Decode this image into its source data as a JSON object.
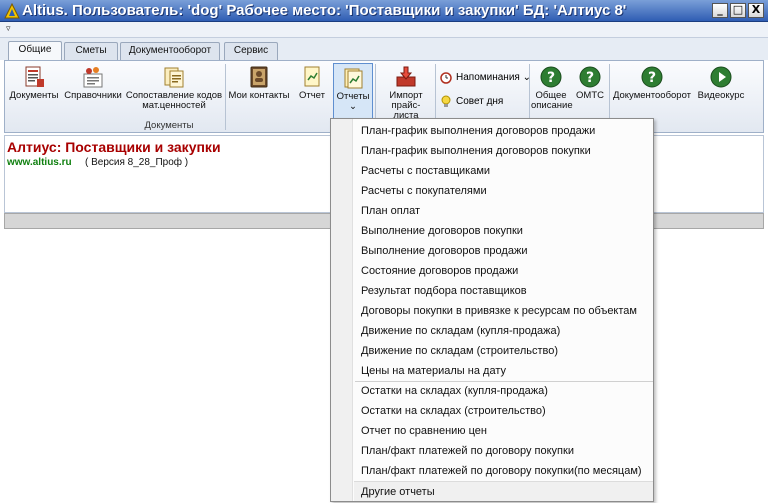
{
  "window": {
    "title": "Altius. Пользователь: 'dog' Рабочее место: 'Поставщики и закупки' БД: 'Алтиус 8'",
    "controls": [
      "_",
      "□",
      "X"
    ]
  },
  "qat": {
    "drop": "▿"
  },
  "tabs": [
    {
      "label": "Общие",
      "active": true
    },
    {
      "label": "Сметы"
    },
    {
      "label": "Документооборот"
    },
    {
      "label": "Сервис"
    }
  ],
  "ribbon": {
    "buttons": {
      "documents": "Документы",
      "references": "Справочники",
      "codes_line1": "Сопоставление кодов",
      "codes_line2": "мат.ценностей",
      "contacts": "Мои контакты",
      "report": "Отчет",
      "reports": "Отчеты",
      "reports_arrow": "⌄",
      "import_line1": "Импорт",
      "import_line2": "прайс-листа",
      "reminders": "Напоминания",
      "reminders_arrow": "⌄",
      "tip": "Совет дня",
      "general_line1": "Общее",
      "general_line2": "описание",
      "omts": "ОМТС",
      "docflow": "Документооборот",
      "video": "Видеокурс"
    },
    "group_label": "Документы"
  },
  "info": {
    "app_name": "Алтиус: Поставщики и закупки",
    "site": "www.altius.ru",
    "version": "( Версия 8_28_Проф              )"
  },
  "menu": {
    "items": [
      "План-график выполнения договоров продажи",
      "План-график выполнения договоров покупки",
      "Расчеты с поставщиками",
      "Расчеты с покупателями",
      "План оплат",
      "Выполнение договоров покупки",
      "Выполнение договоров продажи",
      "Состояние договоров продажи",
      "Результат подбора поставщиков",
      "Договоры покупки в привязке к ресурсам по объектам",
      "Движение по складам (купля-продажа)",
      "Движение по складам (строительство)",
      "Цены на материалы на дату",
      "Остатки на складах (купля-продажа)",
      "Остатки на складах (строительство)",
      "Отчет по сравнению цен",
      "План/факт платежей по договору покупки",
      "План/факт платежей по договору покупки(по месяцам)",
      "Другие отчеты"
    ]
  },
  "colors": {
    "titlebar": "#2f5db3",
    "app_name": "#a80000",
    "site": "#108010",
    "help_icon": "#2e7d32"
  }
}
